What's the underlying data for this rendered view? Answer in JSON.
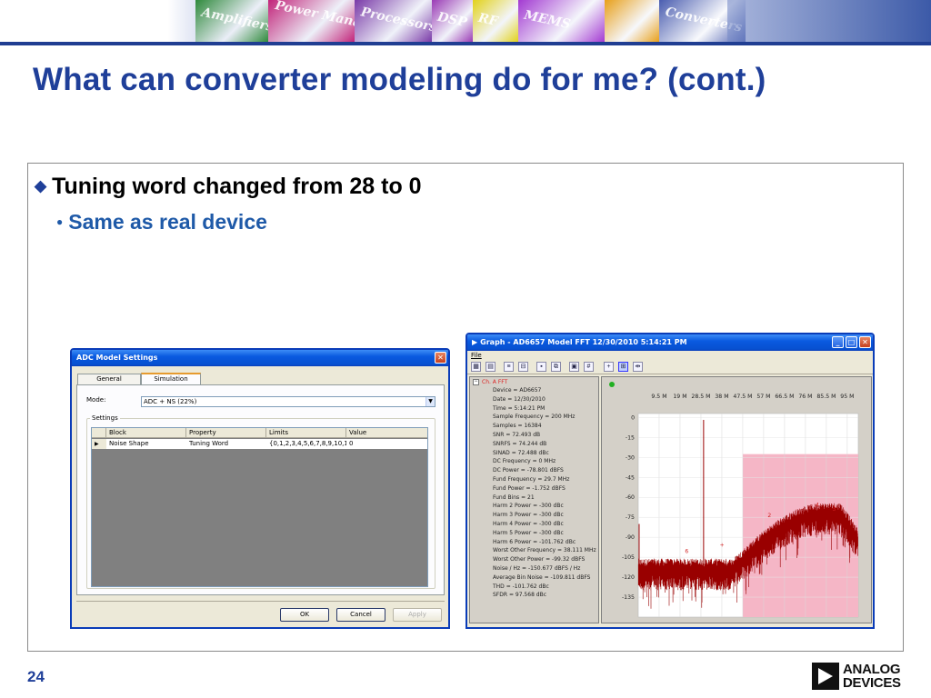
{
  "banner": {
    "tiles": [
      {
        "label": "Amplifiers",
        "color": "#2f8a3c"
      },
      {
        "label": "Power Management",
        "color": "#c2247a"
      },
      {
        "label": "Processors",
        "color": "#7a3aa8"
      },
      {
        "label": "DSP",
        "color": "#9a3ab5"
      },
      {
        "label": "RF",
        "color": "#e2d21a"
      },
      {
        "label": "MEMS",
        "color": "#a33ad2"
      },
      {
        "label": "",
        "color": "#e8a01a"
      },
      {
        "label": "Converters",
        "color": "#4a5db0"
      }
    ]
  },
  "slide": {
    "title": "What can converter modeling do for me? (cont.)",
    "bullet1": "Tuning word changed from 28 to 0",
    "bullet2": "Same as real device",
    "bullet1_mark": "◆",
    "bullet2_mark": "●",
    "page_number": "24"
  },
  "logo": {
    "line1": "ANALOG",
    "line2": "DEVICES"
  },
  "adc_window": {
    "title": "ADC Model Settings",
    "tabs": [
      "General",
      "Simulation"
    ],
    "active_tab": 1,
    "mode_label": "Mode:",
    "mode_value": "ADC + NS (22%)",
    "settings_label": "Settings",
    "columns": [
      "Block",
      "Property",
      "Limits",
      "Value"
    ],
    "row_marker": "▶",
    "row": [
      "Noise Shape",
      "Tuning Word",
      "{0,1,2,3,4,5,6,7,8,9,10,1",
      "0"
    ],
    "buttons": {
      "ok": "OK",
      "cancel": "Cancel",
      "apply": "Apply"
    }
  },
  "graph_window": {
    "title": "Graph - AD6657 Model FFT 12/30/2010 5:14:21 PM",
    "title_icon": "▶",
    "menu_file": "File",
    "tree_root": "Ch. A FFT",
    "tree_items": [
      "Device = AD6657",
      "Date = 12/30/2010",
      "Time = 5:14:21 PM",
      "Sample Frequency = 200 MHz",
      "Samples = 16384",
      "SNR = 72.493 dB",
      "SNRFS = 74.244 dB",
      "SINAD = 72.488 dBc",
      "DC Frequency = 0 MHz",
      "DC Power = -78.801 dBFS",
      "Fund Frequency = 29.7 MHz",
      "Fund Power = -1.752 dBFS",
      "Fund Bins = 21",
      "Harm 2 Power = -300 dBc",
      "Harm 3 Power = -300 dBc",
      "Harm 4 Power = -300 dBc",
      "Harm 5 Power = -300 dBc",
      "Harm 6 Power = -101.762 dBc",
      "Worst Other Frequency = 38.111 MHz",
      "Worst Other Power = -99.32 dBFS",
      "Noise / Hz = -150.677 dBFS / Hz",
      "Average Bin Noise = -109.811 dBFS",
      "THD = -101.762 dBc",
      "SFDR = 97.568 dBc"
    ],
    "plot": {
      "x_ticks": [
        "9.5 M",
        "19 M",
        "28.5 M",
        "38 M",
        "47.5 M",
        "57 M",
        "66.5 M",
        "76 M",
        "85.5 M",
        "95 M"
      ],
      "x_tick_values": [
        9.5,
        19,
        28.5,
        38,
        47.5,
        57,
        66.5,
        76,
        85.5,
        95
      ],
      "y_ticks": [
        "0",
        "-15",
        "-30",
        "-45",
        "-60",
        "-75",
        "-90",
        "-105",
        "-120",
        "-135"
      ],
      "y_tick_values": [
        0,
        -15,
        -30,
        -45,
        -60,
        -75,
        -90,
        -105,
        -120,
        -135
      ],
      "xlim": [
        0,
        100
      ],
      "ylim": [
        -150,
        3
      ],
      "band_start_mhz": 47.5,
      "fund_mhz": 29.7,
      "fund_dbfs": -1.752,
      "harmonic_labels": [
        {
          "label": "2",
          "x": 59.6,
          "y": -75
        },
        {
          "label": "4",
          "x": 81.4,
          "y": -67
        },
        {
          "label": "3",
          "x": 89,
          "y": -70
        },
        {
          "label": "6",
          "x": 22,
          "y": -102
        },
        {
          "label": "+",
          "x": 38.1,
          "y": -97
        }
      ],
      "trace_color": "#990000",
      "band_color": "#f5b6c6"
    }
  },
  "icons": {
    "minimize": "minimize-icon",
    "maximize": "maximize-icon",
    "close": "close-icon"
  }
}
